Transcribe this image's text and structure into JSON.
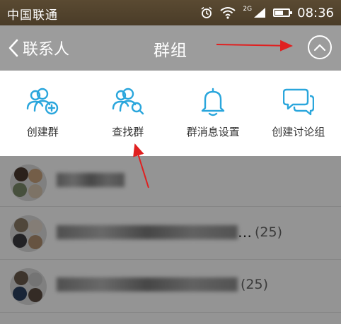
{
  "status_bar": {
    "carrier": "中国联通",
    "network_tag": "2G",
    "time": "08:36",
    "icons": [
      "alarm-icon",
      "wifi-icon",
      "signal-icon",
      "battery-icon"
    ],
    "battery_level": 0.6
  },
  "nav": {
    "back_label": "联系人",
    "title": "群组",
    "collapse_icon": "chevron-up-icon"
  },
  "actions": [
    {
      "label": "创建群",
      "icon": "create-group-icon"
    },
    {
      "label": "查找群",
      "icon": "search-group-icon"
    },
    {
      "label": "群消息设置",
      "icon": "bell-icon"
    },
    {
      "label": "创建讨论组",
      "icon": "chat-bubbles-icon"
    }
  ],
  "groups": [
    {
      "title_suffix": "",
      "count": ""
    },
    {
      "title_suffix": "…",
      "count": "(25)"
    },
    {
      "title_suffix": "",
      "count": "(25)"
    }
  ],
  "colors": {
    "accent_blue": "#2aa6dc",
    "nav_gray": "#9c9c9c",
    "annotation_red": "#e02020"
  }
}
